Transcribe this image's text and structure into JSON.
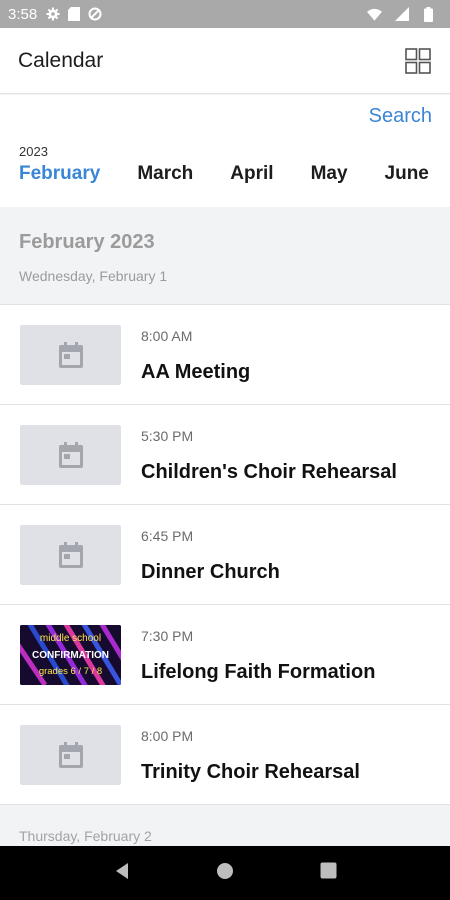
{
  "status_bar": {
    "time": "3:58"
  },
  "app_bar": {
    "title": "Calendar"
  },
  "month_strip": {
    "search_label": "Search",
    "year": "2023",
    "months": [
      {
        "label": "February",
        "active": true
      },
      {
        "label": "March",
        "active": false
      },
      {
        "label": "April",
        "active": false
      },
      {
        "label": "May",
        "active": false
      },
      {
        "label": "June",
        "active": false
      }
    ]
  },
  "section": {
    "month_title": "February 2023",
    "day_label": "Wednesday, February 1"
  },
  "events": [
    {
      "time": "8:00 AM",
      "name": "AA Meeting",
      "thumbnail": "calendar-placeholder"
    },
    {
      "time": "5:30 PM",
      "name": "Children's Choir Rehearsal",
      "thumbnail": "calendar-placeholder"
    },
    {
      "time": "6:45 PM",
      "name": "Dinner Church",
      "thumbnail": "calendar-placeholder"
    },
    {
      "time": "7:30 PM",
      "name": "Lifelong Faith Formation",
      "thumbnail": "image",
      "thumb_text": [
        "middle school",
        "CONFIRMATION",
        "grades 6 / 7 / 8"
      ]
    },
    {
      "time": "8:00 PM",
      "name": "Trinity Choir Rehearsal",
      "thumbnail": "calendar-placeholder"
    }
  ],
  "next_day_label": "Thursday, February 2",
  "colors": {
    "accent": "#3a86d6",
    "placeholder": "#dfe1e6"
  }
}
